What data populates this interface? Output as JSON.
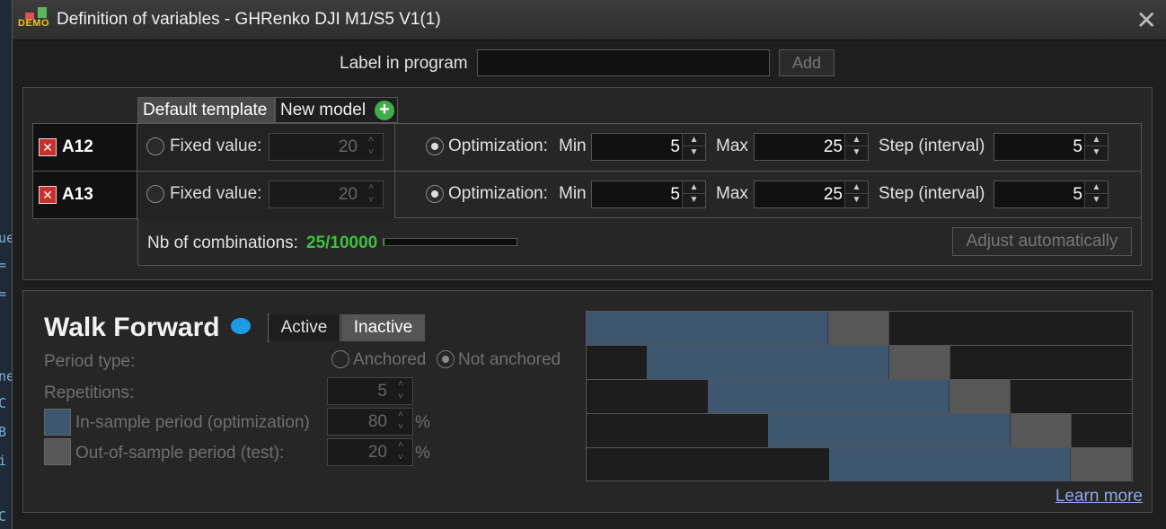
{
  "window": {
    "title": "Definition of variables - GHRenko DJI M1/S5 V1(1)",
    "demo_badge": "DEMO"
  },
  "bg_code": [
    "ue",
    "=",
    "=",
    "ne",
    "C",
    "B",
    "i",
    "C"
  ],
  "label_row": {
    "label": "Label in program",
    "input_value": "",
    "add_button": "Add"
  },
  "tabs": {
    "default": "Default template",
    "new": "New model"
  },
  "variables": [
    {
      "name": "A12",
      "fixed_label": "Fixed value:",
      "fixed_value": "20",
      "opt_label": "Optimization:",
      "min_label": "Min",
      "min": "5",
      "max_label": "Max",
      "max": "25",
      "step_label": "Step (interval)",
      "step": "5"
    },
    {
      "name": "A13",
      "fixed_label": "Fixed value:",
      "fixed_value": "20",
      "opt_label": "Optimization:",
      "min_label": "Min",
      "min": "5",
      "max_label": "Max",
      "max": "25",
      "step_label": "Step (interval)",
      "step": "5"
    }
  ],
  "combinations": {
    "label": "Nb of combinations:",
    "value": "25/10000",
    "progress_fraction": 0.0025,
    "adjust_button": "Adjust automatically"
  },
  "walk_forward": {
    "title": "Walk Forward",
    "active_label": "Active",
    "inactive_label": "Inactive",
    "selected": "Inactive",
    "period_type_label": "Period type:",
    "anchored_label": "Anchored",
    "not_anchored_label": "Not anchored",
    "repetitions_label": "Repetitions:",
    "repetitions": "5",
    "in_sample_label": "In-sample period (optimization)",
    "in_sample": "80",
    "out_sample_label": "Out-of-sample period (test):",
    "out_sample": "20",
    "pct": "%",
    "learn_more": "Learn more",
    "colors": {
      "in_sample": "#3f5670",
      "out_sample": "#575757"
    }
  }
}
